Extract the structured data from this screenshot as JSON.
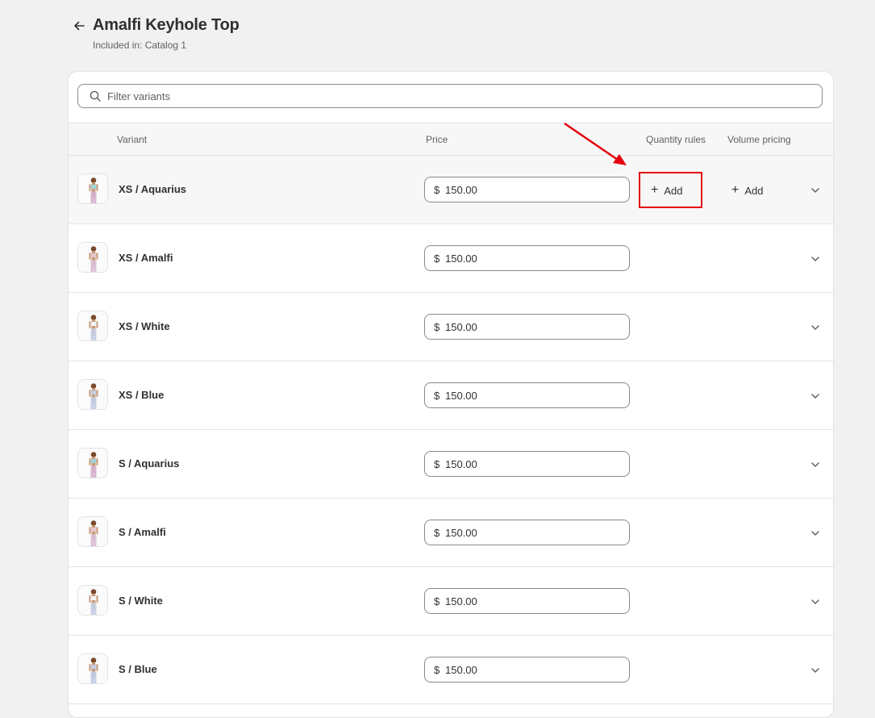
{
  "header": {
    "title": "Amalfi Keyhole Top",
    "subtitle": "Included in: Catalog 1"
  },
  "search": {
    "placeholder": "Filter variants",
    "value": ""
  },
  "columns": {
    "variant": "Variant",
    "price": "Price",
    "quantity_rules": "Quantity rules",
    "volume_pricing": "Volume pricing"
  },
  "add_label": "Add",
  "rows": [
    {
      "name": "XS / Aquarius",
      "currency": "$",
      "price": "150.00",
      "top_color": "#9fd4d8",
      "bottom_color": "#d6b6d2"
    },
    {
      "name": "XS / Amalfi",
      "currency": "$",
      "price": "150.00",
      "top_color": "#e6c7cf",
      "bottom_color": "#dcc0d6"
    },
    {
      "name": "XS / White",
      "currency": "$",
      "price": "150.00",
      "top_color": "#f4f4f4",
      "bottom_color": "#c8d0e6"
    },
    {
      "name": "XS / Blue",
      "currency": "$",
      "price": "150.00",
      "top_color": "#c4cfe5",
      "bottom_color": "#c4cfe5"
    },
    {
      "name": "S / Aquarius",
      "currency": "$",
      "price": "150.00",
      "top_color": "#9fd4d8",
      "bottom_color": "#d6b6d2"
    },
    {
      "name": "S / Amalfi",
      "currency": "$",
      "price": "150.00",
      "top_color": "#e6c7cf",
      "bottom_color": "#dcc0d6"
    },
    {
      "name": "S / White",
      "currency": "$",
      "price": "150.00",
      "top_color": "#f4f4f4",
      "bottom_color": "#c8d0e6"
    },
    {
      "name": "S / Blue",
      "currency": "$",
      "price": "150.00",
      "top_color": "#c4cfe5",
      "bottom_color": "#c4cfe5"
    }
  ],
  "colors": {
    "page_bg": "#f1f1f1",
    "card_bg": "#ffffff",
    "highlight_row_bg": "#f7f7f7",
    "annotation_red": "#e4000f",
    "skin": "#c99a78",
    "hair": "#7a4a2c"
  },
  "icons": {
    "back": "arrow-left-icon",
    "search": "search-icon",
    "plus": "plus-icon",
    "expand": "chevron-down-icon"
  }
}
